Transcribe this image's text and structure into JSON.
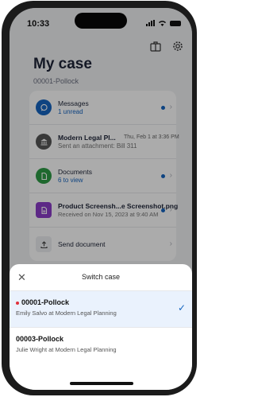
{
  "status_bar": {
    "time": "10:33"
  },
  "header": {
    "title": "My case",
    "case_id": "00001-Pollock"
  },
  "items": [
    {
      "title": "Messages",
      "subtitle": "1 unread",
      "unread": true
    },
    {
      "title": "Modern Legal Pl...",
      "date": "Thu, Feb 1 at 3:36 PM",
      "subtitle": "Sent an attachment: Bill 311",
      "unread": false
    },
    {
      "title": "Documents",
      "subtitle": "6 to view",
      "unread": true
    },
    {
      "title": "Product Screensh...e Screenshot.png",
      "subtitle": "Received on Nov 15, 2023 at 9:40 AM",
      "unread": true
    },
    {
      "title": "Send document",
      "subtitle": "",
      "unread": false
    }
  ],
  "sheet": {
    "title": "Switch case",
    "cases": [
      {
        "id": "00001-Pollock",
        "detail": "Emily Salvo at Modern Legal Planning",
        "selected": true
      },
      {
        "id": "00003-Pollock",
        "detail": "Julie Wright at Modern Legal Planning",
        "selected": false
      }
    ]
  },
  "colors": {
    "accent": "#1565c0",
    "unread_dot": "#e0303b",
    "title": "#1e2538",
    "documents_icon": "#2e9b45",
    "file_icon": "#8b3dc8"
  },
  "icons": [
    "briefcase-icon",
    "gear-icon",
    "chat-bubble-icon",
    "bank-icon",
    "document-icon",
    "file-icon",
    "upload-icon",
    "close-icon",
    "checkmark-icon"
  ]
}
